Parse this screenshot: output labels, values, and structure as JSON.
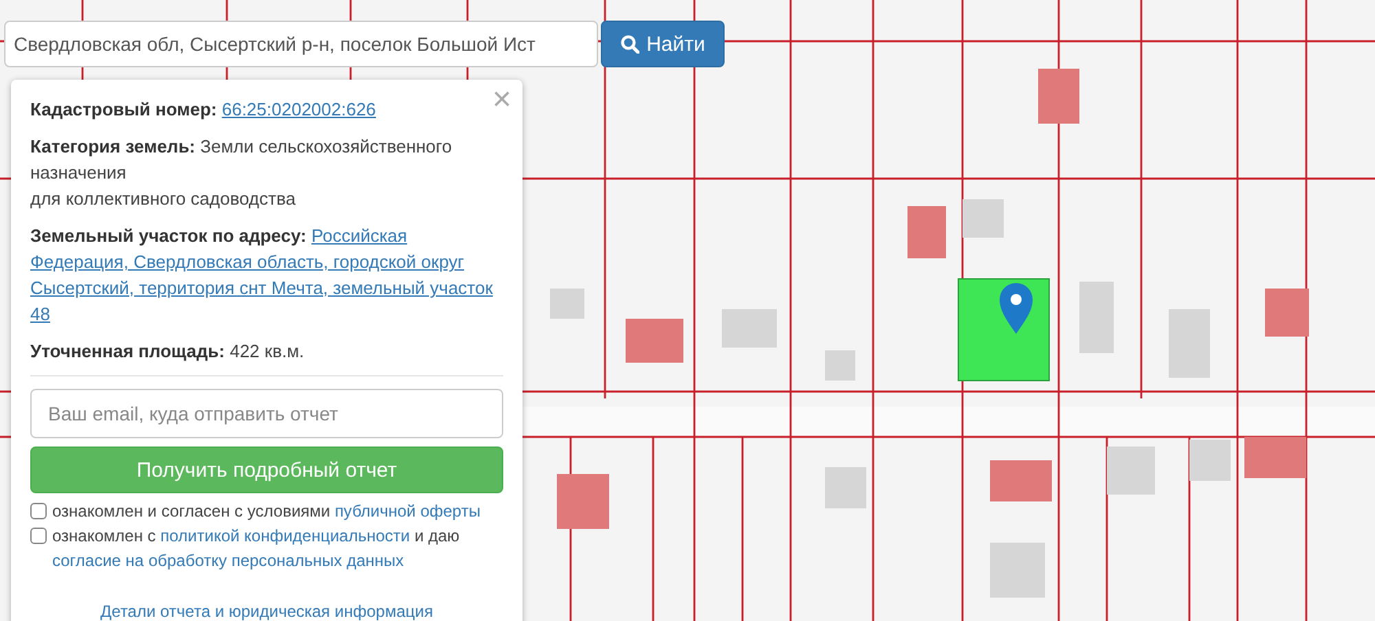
{
  "search": {
    "value": "Свердловская обл, Сысертский р-н, поселок Большой Ист",
    "button": "Найти"
  },
  "panel": {
    "close": "×",
    "fields": [
      {
        "kind": "link",
        "label": "Кадастровый номер:",
        "links": [
          "66:25:0202002:626"
        ]
      },
      {
        "kind": "text",
        "text": "**Категория земель:** Земли сельскохозяйственного назначения",
        "extra": "для коллективного садоводства"
      },
      {
        "kind": "link",
        "label": "Земельный участок по адресу:",
        "links": [
          "Российская",
          "Федерация, Свердловская область, городской округ",
          "Сысертский, территория снт Мечта, земельный участок",
          "48"
        ]
      },
      {
        "kind": "text",
        "text": "**Уточненная площадь:** 422 кв.м."
      }
    ],
    "email": {
      "placeholder": "Ваш email, куда отправить отчет"
    },
    "submit": "Получить подробный отчет",
    "consents": [
      {
        "checked": false,
        "parts": [
          {
            "kind": "text",
            "text": "ознакомлен и согласен с условиями "
          },
          {
            "kind": "link",
            "text": "публичной оферты"
          }
        ]
      },
      {
        "checked": false,
        "parts": [
          {
            "kind": "text",
            "text": "ознакомлен с "
          },
          {
            "kind": "link",
            "text": "политикой конфиденциальности"
          },
          {
            "kind": "text",
            "text": " и даю "
          },
          {
            "kind": "link",
            "text": "согласие на обработку персональных данных"
          }
        ]
      }
    ],
    "footer_link": "Детали отчета и юридическая информация"
  }
}
